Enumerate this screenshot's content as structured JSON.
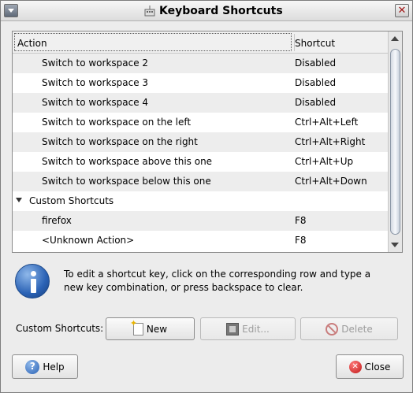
{
  "window": {
    "title": "Keyboard Shortcuts"
  },
  "table": {
    "headers": {
      "action": "Action",
      "shortcut": "Shortcut"
    },
    "rows": [
      {
        "action": "Switch to workspace 2",
        "shortcut": "Disabled"
      },
      {
        "action": "Switch to workspace 3",
        "shortcut": "Disabled"
      },
      {
        "action": "Switch to workspace 4",
        "shortcut": "Disabled"
      },
      {
        "action": "Switch to workspace on the left",
        "shortcut": "Ctrl+Alt+Left"
      },
      {
        "action": "Switch to workspace on the right",
        "shortcut": "Ctrl+Alt+Right"
      },
      {
        "action": "Switch to workspace above this one",
        "shortcut": "Ctrl+Alt+Up"
      },
      {
        "action": "Switch to workspace below this one",
        "shortcut": "Ctrl+Alt+Down"
      },
      {
        "action": "Custom Shortcuts",
        "shortcut": ""
      },
      {
        "action": "firefox",
        "shortcut": "F8"
      },
      {
        "action": "<Unknown Action>",
        "shortcut": "F8"
      }
    ]
  },
  "info": {
    "text": "To edit a shortcut key, click on the corresponding row and type a new key combination, or press backspace to clear."
  },
  "custom": {
    "label": "Custom Shortcuts:",
    "new_label": "New",
    "edit_label": "Edit...",
    "delete_label": "Delete"
  },
  "footer": {
    "help_label": "Help",
    "close_label": "Close"
  },
  "icons": {
    "title": "keyboard-icon",
    "info": "info-icon",
    "new": "new-document-icon",
    "edit": "edit-icon",
    "delete": "delete-icon",
    "help": "help-icon",
    "close": "close-icon"
  }
}
